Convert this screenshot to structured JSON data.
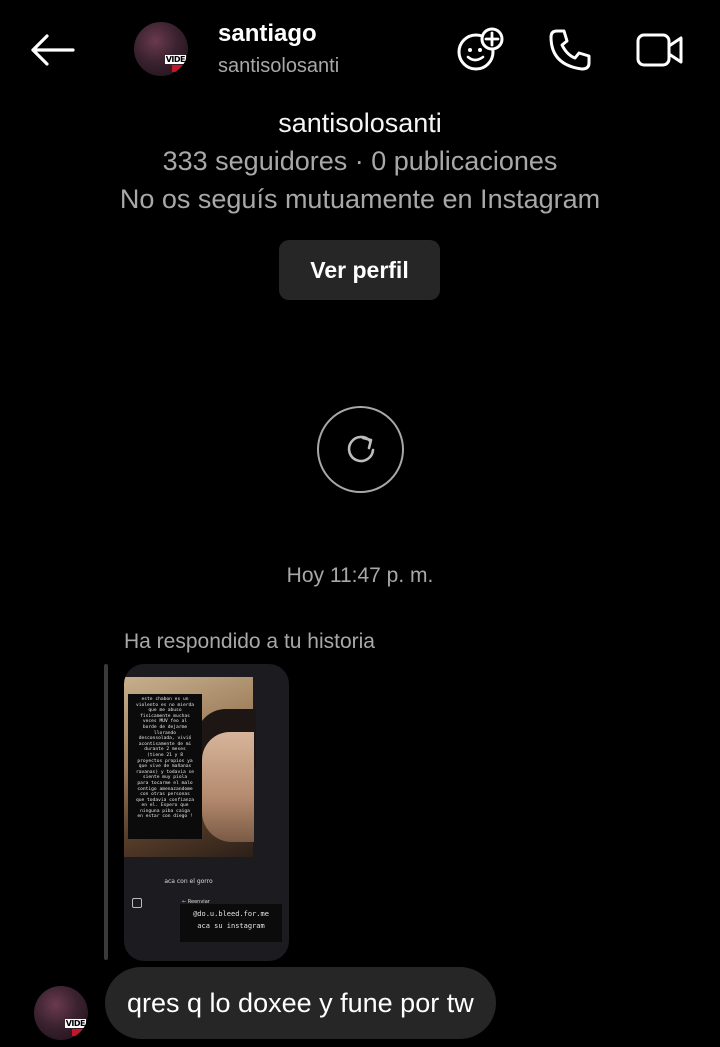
{
  "header": {
    "name": "santiago",
    "username": "santisolosanti",
    "avatar_tag": "VIDE",
    "icons": [
      "back-arrow-icon",
      "effects-sticker-icon",
      "phone-icon",
      "video-camera-icon"
    ]
  },
  "profile": {
    "username": "santisolosanti",
    "stats": "333 seguidores · 0 publicaciones",
    "mutual": "No os seguís mutuamente en Instagram",
    "view_profile_label": "Ver perfil"
  },
  "chat": {
    "timestamp": "Hoy 11:47 p. m.",
    "reply_label": "Ha respondido a tu historia",
    "story": {
      "text_lines": [
        "este chabon es un",
        "violento es no mierda",
        "que me abuso",
        "fisicamente muchas",
        "veces MUV feo al",
        "borde de dejarme",
        "llorando",
        "desconsolada, vivió",
        "acontisamente de mi",
        "durante 2 meses",
        "(tiene 21 y 8",
        "proyectos propios ya",
        "que vive de mañanas",
        "ravanas) y todavia se",
        "siente muy piola",
        "para tocarme el malo",
        "contigo amenazandome",
        "con otras personas",
        "que todavia confianza",
        "en el. Espero que",
        "ninguna piba caiga",
        "en estar con diego !"
      ],
      "caption": "aca con el gorro",
      "forward_label": "← Reenviar",
      "handle": "@do.u.bleed.for.me",
      "handle_sub": "aca su instagram"
    },
    "message": "qres q lo doxee y fune por tw"
  }
}
